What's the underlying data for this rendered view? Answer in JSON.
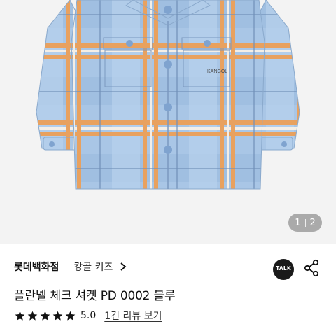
{
  "gallery": {
    "image_alt": "",
    "current_page": "1",
    "total_pages": "2",
    "colors": {
      "background": "#f3f3f3",
      "fabric": "#a9c6e6",
      "stripe_orange": "#e8a15f",
      "stripe_white": "#f4eee6",
      "stripe_dark": "#6f8fb8",
      "button": "#7fa3cf"
    },
    "icons": [
      "jacket-product-image"
    ]
  },
  "brand": {
    "store": "롯데백화점",
    "name": "캉골 키즈",
    "chevron_icon": "chevron-right-icon"
  },
  "actions": {
    "talk_label": "TALK",
    "talk_icon": "talk-chat-icon",
    "share_icon": "share-icon"
  },
  "product": {
    "title": "플란넬 체크 셔켓 PD 0002 블루"
  },
  "rating": {
    "stars": 5,
    "score": "5.0",
    "review_link": "1건 리뷰 보기",
    "star_color": "#111111"
  }
}
